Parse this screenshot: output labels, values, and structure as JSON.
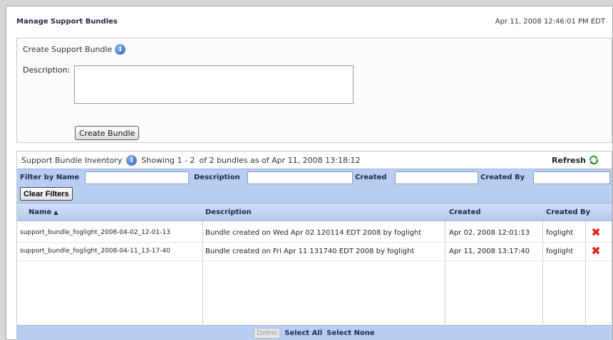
{
  "header": {
    "title": "Manage Support Bundles",
    "timestamp": "Apr 11, 2008 12:46:01 PM EDT"
  },
  "create": {
    "title": "Create Support Bundle",
    "description_label": "Description:",
    "description_value": "",
    "button_label": "Create Bundle"
  },
  "inventory": {
    "title": "Support Bundle Inventory",
    "showing": "Showing 1 - 2",
    "of_text": "of 2 bundles as of Apr 11, 2008 13:18:12",
    "refresh_label": "Refresh"
  },
  "filters": {
    "name_label": "Filter by Name",
    "description_label": "Description",
    "created_label": "Created",
    "created_by_label": "Created By",
    "clear_label": "Clear Filters"
  },
  "table": {
    "columns": [
      "Name",
      "Description",
      "Created",
      "Created By"
    ],
    "rows": [
      {
        "name": "support_bundle_foglight_2008-04-02_12-01-13",
        "description": "Bundle created on Wed Apr 02 120114 EDT 2008 by foglight",
        "created": "Apr 02, 2008 12:01:13",
        "created_by": "foglight"
      },
      {
        "name": "support_bundle_foglight_2008-04-11_13-17-40",
        "description": "Bundle created on Fri Apr 11 131740 EDT 2008 by foglight",
        "created": "Apr 11, 2008 13:17:40",
        "created_by": "foglight"
      }
    ]
  },
  "footer": {
    "delete_label": "Delete",
    "select_all_label": "Select All",
    "select_none_label": "Select None"
  },
  "icons": {
    "info": "info-icon",
    "refresh": "refresh-icon",
    "delete": "delete-x-icon",
    "sort": "sort-ascending-icon"
  },
  "colors": {
    "header_bar": "#b8cdf2",
    "delete_x": "#e02020"
  }
}
